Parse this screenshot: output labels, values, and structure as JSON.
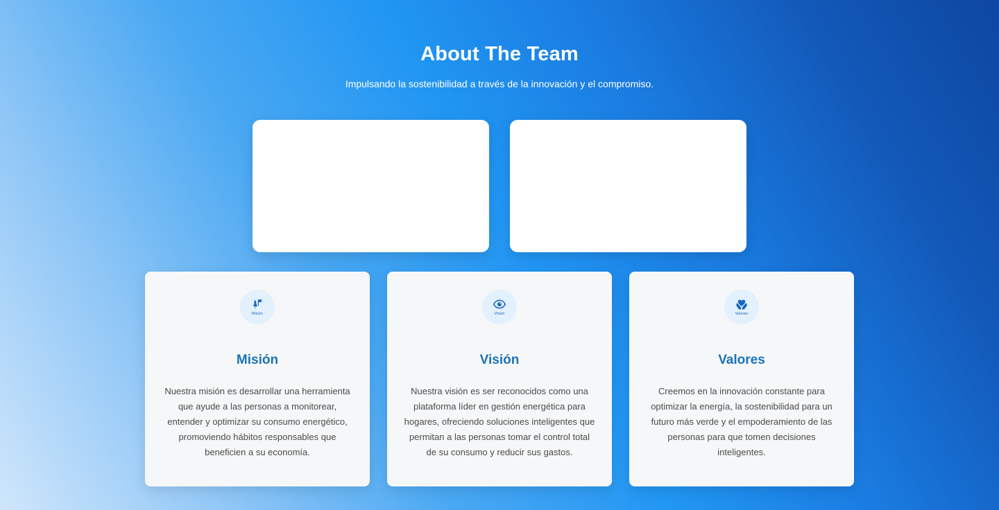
{
  "header": {
    "title": "About The Team",
    "subtitle": "Impulsando la sostenibilidad a través de la innovación y el compromiso."
  },
  "colors": {
    "card_title": "#1a73b8",
    "icon_bg": "#e3f0fd",
    "icon_color": "#1565c0",
    "card_bg": "#f6f7f8"
  },
  "cards": [
    {
      "icon": "rocket-flag-icon",
      "icon_caption": "Misión",
      "title": "Misión",
      "text": "Nuestra misión es desarrollar una herramienta que ayude a las personas a monitorear, entender y optimizar su consumo energético, promoviendo hábitos responsables que beneficien a su economía."
    },
    {
      "icon": "eye-icon",
      "icon_caption": "Visión",
      "title": "Visión",
      "text": "Nuestra visión es ser reconocidos como una plataforma líder en gestión energética para hogares, ofreciendo soluciones inteligentes que permitan a las personas tomar el control total de su consumo y reducir sus gastos."
    },
    {
      "icon": "heart-hands-icon",
      "icon_caption": "Valores",
      "title": "Valores",
      "text": "Creemos en la innovación constante para optimizar la energía, la sostenibilidad para un futuro más verde y el empoderamiento de las personas para que tomen decisiones inteligentes."
    }
  ]
}
